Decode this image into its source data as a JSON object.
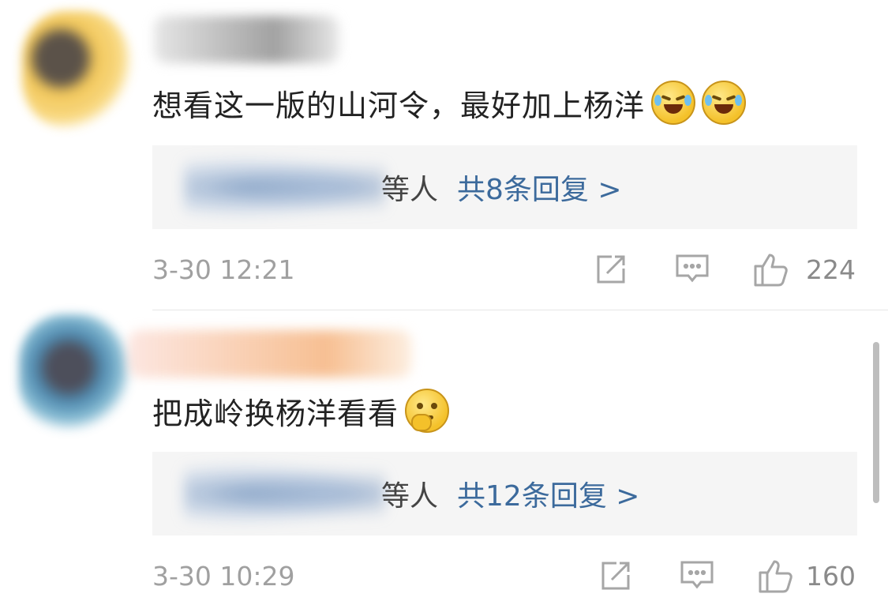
{
  "comments": [
    {
      "text": "想看这一版的山河令，最好加上杨洋",
      "emoji_icons": [
        "crying-laughing-emoji",
        "crying-laughing-emoji"
      ],
      "reply_others": "等人",
      "reply_count_label": "共8条回复 >",
      "time": "3-30 12:21",
      "likes": "224"
    },
    {
      "text": "把成岭换杨洋看看",
      "emoji_icons": [
        "thinking-emoji"
      ],
      "reply_others": "等人",
      "reply_count_label": "共12条回复 >",
      "time": "3-30 10:29",
      "likes": "160"
    }
  ],
  "colors": {
    "link": "#3c6a9c",
    "meta": "#a0a0a0",
    "reply_bg": "#f5f5f5"
  },
  "icons": [
    "repost-icon",
    "comment-icon",
    "thumbs-up-icon"
  ]
}
